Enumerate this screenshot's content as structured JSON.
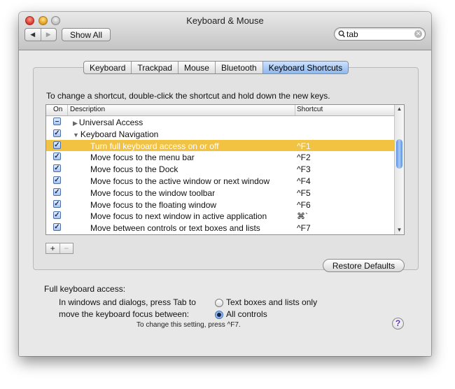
{
  "window": {
    "title": "Keyboard & Mouse"
  },
  "toolbar": {
    "back_glyph": "◀",
    "forward_glyph": "▶",
    "show_all_label": "Show All",
    "search_value": "tab"
  },
  "tabs": [
    {
      "label": "Keyboard",
      "active": false
    },
    {
      "label": "Trackpad",
      "active": false
    },
    {
      "label": "Mouse",
      "active": false
    },
    {
      "label": "Bluetooth",
      "active": false
    },
    {
      "label": "Keyboard Shortcuts",
      "active": true
    }
  ],
  "instructions": "To change a shortcut, double-click the shortcut and hold down the new keys.",
  "table": {
    "columns": {
      "on": "On",
      "description": "Description",
      "shortcut": "Shortcut"
    },
    "rows": [
      {
        "state": "mixed",
        "mark": "–",
        "indent": 1,
        "disclosure": "▶",
        "description": "Universal Access",
        "shortcut": "",
        "selected": false
      },
      {
        "state": "on",
        "mark": "✓",
        "indent": 1,
        "disclosure": "▼",
        "description": "Keyboard Navigation",
        "shortcut": "",
        "selected": false
      },
      {
        "state": "on",
        "mark": "✓",
        "indent": 2,
        "disclosure": "",
        "description": "Turn full keyboard access on or off",
        "shortcut": "^F1",
        "selected": true
      },
      {
        "state": "on",
        "mark": "✓",
        "indent": 2,
        "disclosure": "",
        "description": "Move focus to the menu bar",
        "shortcut": "^F2",
        "selected": false
      },
      {
        "state": "on",
        "mark": "✓",
        "indent": 2,
        "disclosure": "",
        "description": "Move focus to the Dock",
        "shortcut": "^F3",
        "selected": false
      },
      {
        "state": "on",
        "mark": "✓",
        "indent": 2,
        "disclosure": "",
        "description": "Move focus to the active window or next window",
        "shortcut": "^F4",
        "selected": false
      },
      {
        "state": "on",
        "mark": "✓",
        "indent": 2,
        "disclosure": "",
        "description": "Move focus to the window toolbar",
        "shortcut": "^F5",
        "selected": false
      },
      {
        "state": "on",
        "mark": "✓",
        "indent": 2,
        "disclosure": "",
        "description": "Move focus to the floating window",
        "shortcut": "^F6",
        "selected": false
      },
      {
        "state": "on",
        "mark": "✓",
        "indent": 2,
        "disclosure": "",
        "description": "Move focus to next window in active application",
        "shortcut": "⌘`",
        "selected": false
      },
      {
        "state": "on",
        "mark": "✓",
        "indent": 2,
        "disclosure": "",
        "description": "Move between controls or text boxes and lists",
        "shortcut": "^F7",
        "selected": false
      }
    ]
  },
  "buttons": {
    "add_label": "+",
    "remove_label": "−",
    "restore_defaults_label": "Restore Defaults"
  },
  "full_keyboard_access": {
    "label": "Full keyboard access:",
    "description_line1": "In windows and dialogs, press Tab to",
    "description_line2": "move the keyboard focus between:",
    "options": [
      {
        "label": "Text boxes and lists only",
        "selected": false
      },
      {
        "label": "All controls",
        "selected": true
      }
    ],
    "hint": "To change this setting, press ^F7."
  },
  "help_label": "?",
  "colors": {
    "selection_row": "#f2c242",
    "active_tab": "#8fb8ec"
  }
}
